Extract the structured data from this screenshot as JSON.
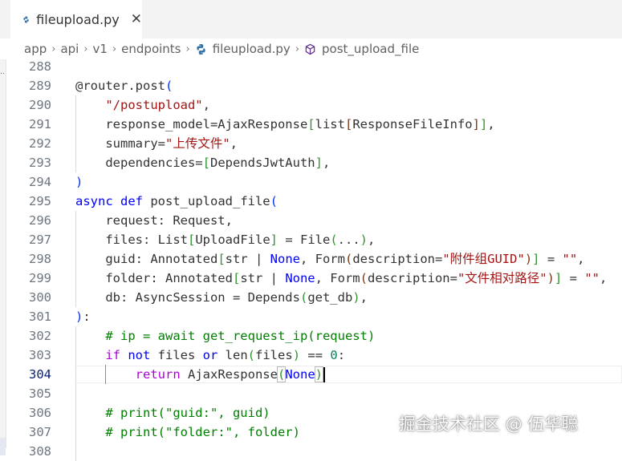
{
  "tab": {
    "filename": "fileupload.py",
    "close_glyph": "✕"
  },
  "breadcrumb": {
    "items": [
      "app",
      "api",
      "v1",
      "endpoints",
      "fileupload.py",
      "post_upload_file"
    ],
    "separator": "›"
  },
  "editor": {
    "active_line": 304,
    "line_numbers": [
      "288",
      "289",
      "290",
      "291",
      "292",
      "293",
      "294",
      "295",
      "296",
      "297",
      "298",
      "299",
      "300",
      "301",
      "302",
      "303",
      "304",
      "305",
      "306",
      "307",
      "308"
    ],
    "lines": [
      [],
      [
        {
          "t": "@router.post"
        },
        {
          "t": "(",
          "c": "b1"
        }
      ],
      [
        {
          "t": "    "
        },
        {
          "t": "\"/postupload\"",
          "c": "str"
        },
        {
          "t": ","
        }
      ],
      [
        {
          "t": "    response_model=AjaxResponse"
        },
        {
          "t": "[",
          "c": "b2"
        },
        {
          "t": "list"
        },
        {
          "t": "[",
          "c": "b3"
        },
        {
          "t": "ResponseFileInfo"
        },
        {
          "t": "]",
          "c": "b3"
        },
        {
          "t": "]",
          "c": "b2"
        },
        {
          "t": ","
        }
      ],
      [
        {
          "t": "    summary="
        },
        {
          "t": "\"上传文件\"",
          "c": "str"
        },
        {
          "t": ","
        }
      ],
      [
        {
          "t": "    dependencies="
        },
        {
          "t": "[",
          "c": "b2"
        },
        {
          "t": "DependsJwtAuth"
        },
        {
          "t": "]",
          "c": "b2"
        },
        {
          "t": ","
        }
      ],
      [
        {
          "t": ")",
          "c": "b1"
        }
      ],
      [
        {
          "t": "async def",
          "c": "kw"
        },
        {
          "t": " post_upload_file"
        },
        {
          "t": "(",
          "c": "b1"
        }
      ],
      [
        {
          "t": "    request: Request,"
        }
      ],
      [
        {
          "t": "    files: List"
        },
        {
          "t": "[",
          "c": "b2"
        },
        {
          "t": "UploadFile"
        },
        {
          "t": "]",
          "c": "b2"
        },
        {
          "t": " = File"
        },
        {
          "t": "(",
          "c": "b2"
        },
        {
          "t": "..."
        },
        {
          "t": ")",
          "c": "b2"
        },
        {
          "t": ","
        }
      ],
      [
        {
          "t": "    guid: Annotated"
        },
        {
          "t": "[",
          "c": "b2"
        },
        {
          "t": "str | "
        },
        {
          "t": "None",
          "c": "kw"
        },
        {
          "t": ", Form"
        },
        {
          "t": "(",
          "c": "b3"
        },
        {
          "t": "description="
        },
        {
          "t": "\"附件组GUID\"",
          "c": "str"
        },
        {
          "t": ")",
          "c": "b3"
        },
        {
          "t": "]",
          "c": "b2"
        },
        {
          "t": " = "
        },
        {
          "t": "\"\"",
          "c": "str"
        },
        {
          "t": ","
        }
      ],
      [
        {
          "t": "    folder: Annotated"
        },
        {
          "t": "[",
          "c": "b2"
        },
        {
          "t": "str | "
        },
        {
          "t": "None",
          "c": "kw"
        },
        {
          "t": ", Form"
        },
        {
          "t": "(",
          "c": "b3"
        },
        {
          "t": "description="
        },
        {
          "t": "\"文件相对路径\"",
          "c": "str"
        },
        {
          "t": ")",
          "c": "b3"
        },
        {
          "t": "]",
          "c": "b2"
        },
        {
          "t": " = "
        },
        {
          "t": "\"\"",
          "c": "str"
        },
        {
          "t": ","
        }
      ],
      [
        {
          "t": "    db: AsyncSession = Depends"
        },
        {
          "t": "(",
          "c": "b2"
        },
        {
          "t": "get_db"
        },
        {
          "t": ")",
          "c": "b2"
        },
        {
          "t": ","
        }
      ],
      [
        {
          "t": ")",
          "c": "b1"
        },
        {
          "t": ":"
        }
      ],
      [
        {
          "t": "    "
        },
        {
          "t": "# ip = await get_request_ip(request)",
          "c": "cmt"
        }
      ],
      [
        {
          "t": "    "
        },
        {
          "t": "if",
          "c": "ctl"
        },
        {
          "t": " "
        },
        {
          "t": "not",
          "c": "kw"
        },
        {
          "t": " files "
        },
        {
          "t": "or",
          "c": "kw"
        },
        {
          "t": " len"
        },
        {
          "t": "(",
          "c": "b2"
        },
        {
          "t": "files"
        },
        {
          "t": ")",
          "c": "b2"
        },
        {
          "t": " == "
        },
        {
          "t": "0",
          "c": "num"
        },
        {
          "t": ":"
        }
      ],
      [
        {
          "t": "        "
        },
        {
          "t": "return",
          "c": "ctl"
        },
        {
          "t": " AjaxResponse"
        },
        {
          "t": "(",
          "c": "b2 bm"
        },
        {
          "t": "None",
          "c": "kw"
        },
        {
          "t": ")",
          "c": "b2 bm"
        }
      ],
      [],
      [
        {
          "t": "    "
        },
        {
          "t": "# print(\"guid:\", guid)",
          "c": "cmt"
        }
      ],
      [
        {
          "t": "    "
        },
        {
          "t": "# print(\"folder:\", folder)",
          "c": "cmt"
        }
      ],
      []
    ]
  },
  "watermark": "掘金技术社区 @ 伍华聪",
  "colors": {
    "keyword": "#0000ff",
    "control": "#af00db",
    "string": "#a31515",
    "number": "#098658",
    "comment": "#008000",
    "bracket_1": "#0431fa",
    "bracket_2": "#319331",
    "bracket_3": "#7b3814"
  }
}
